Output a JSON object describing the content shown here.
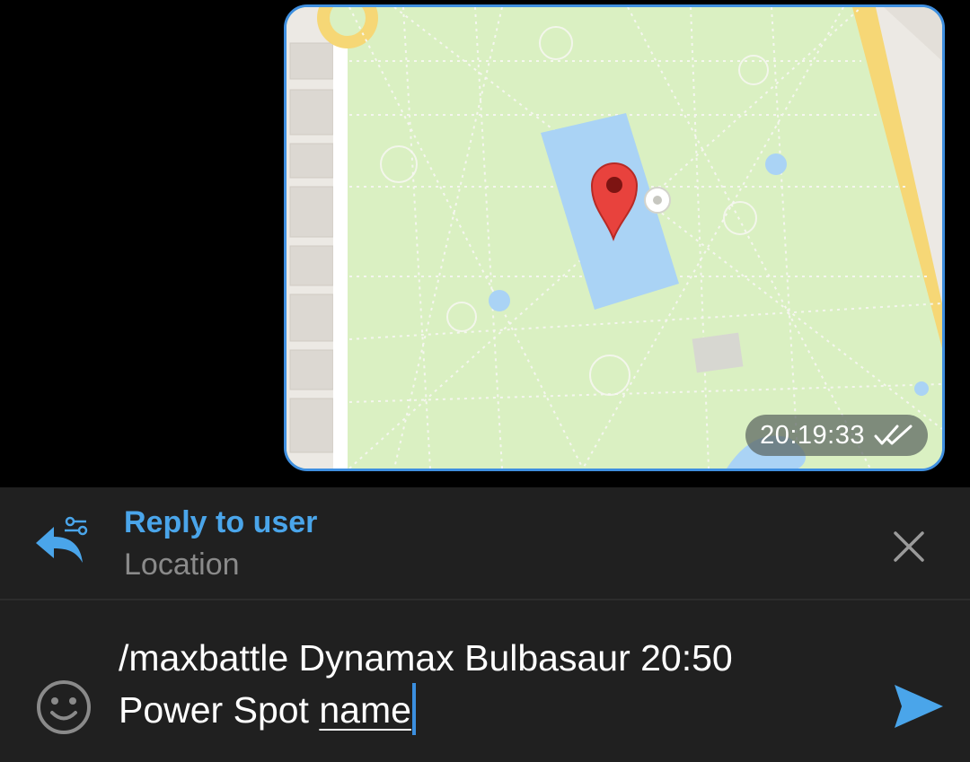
{
  "message": {
    "time": "20:19:33",
    "status_icon": "double-check-icon"
  },
  "map": {
    "park_color": "#daf0c2",
    "water_color": "#aad3f5",
    "road_color": "#f6d776",
    "pin_color": "#e8423d"
  },
  "reply": {
    "title": "Reply to user",
    "subtitle": "Location",
    "icon": "reply-arrow-icon",
    "close_icon": "close-icon"
  },
  "composer": {
    "text_line1": "/maxbattle Dynamax Bulbasaur 20:50",
    "text_line2_plain": "Power Spot ",
    "text_line2_underlined": "name",
    "emoji_icon": "smiley-icon",
    "send_icon": "send-icon"
  },
  "colors": {
    "accent": "#4aa5ea",
    "bubble_border": "#3f8fe0",
    "panel_bg": "#202020",
    "screen_bg": "#000000"
  }
}
